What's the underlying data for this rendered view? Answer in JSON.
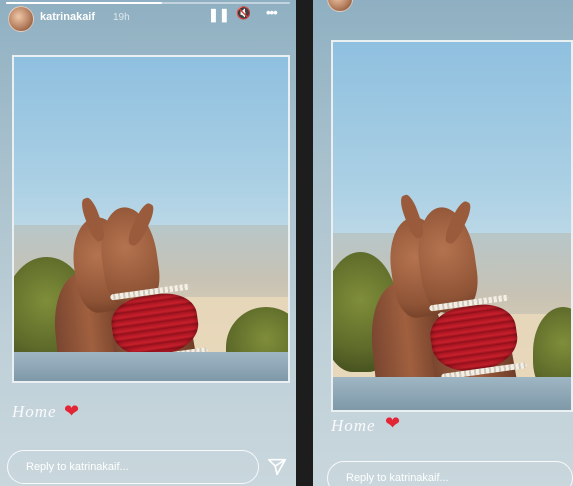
{
  "left_story": {
    "username": "katrinakaif",
    "timestamp": "19h",
    "progress": 0.55,
    "caption": "Home",
    "reply_placeholder": "Reply to katrinakaif..."
  },
  "right_story": {
    "caption": "Home",
    "reply_placeholder": "Reply to katrinakaif..."
  },
  "controls": {
    "pause_glyph": "❚❚",
    "mute_glyph": "🔇",
    "more_glyph": "•••"
  },
  "icons": {
    "heart_glyph": "❤",
    "heart_color": "#e32636"
  }
}
